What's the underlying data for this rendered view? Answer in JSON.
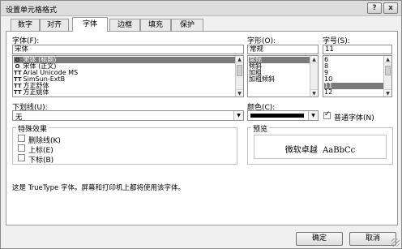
{
  "dialog": {
    "title": "设置单元格格式",
    "help_button": "?",
    "close_button": "x"
  },
  "tabs": [
    {
      "label": "数字"
    },
    {
      "label": "对齐"
    },
    {
      "label": "字体"
    },
    {
      "label": "边框"
    },
    {
      "label": "填充"
    },
    {
      "label": "保护"
    }
  ],
  "active_tab": "字体",
  "font": {
    "label": "字体(F):",
    "value": "宋体",
    "items": [
      {
        "name": "宋体 (标题)",
        "icon": "O"
      },
      {
        "name": "宋体 (正文)",
        "icon": "O"
      },
      {
        "name": "Arial Unicode MS",
        "icon": "TT"
      },
      {
        "name": "SimSun-ExtB",
        "icon": "TT"
      },
      {
        "name": "方正舒体",
        "icon": "TT"
      },
      {
        "name": "方正姚体",
        "icon": "TT"
      }
    ]
  },
  "style": {
    "label": "字形(O):",
    "value": "常规",
    "items": [
      "常规",
      "倾斜",
      "加粗",
      "加粗倾斜"
    ]
  },
  "size": {
    "label": "字号(S):",
    "value": "11",
    "items": [
      "6",
      "8",
      "9",
      "10",
      "11",
      "12"
    ]
  },
  "underline": {
    "label": "下划线(U):",
    "value": "无"
  },
  "color": {
    "label": "颜色(C):",
    "value_color": "#000000"
  },
  "normal_font": {
    "label": "普通字体(N)",
    "checked": true
  },
  "effects": {
    "title": "特殊效果",
    "items": [
      {
        "label": "删除线(K)",
        "checked": false
      },
      {
        "label": "上标(E)",
        "checked": false
      },
      {
        "label": "下标(B)",
        "checked": false
      }
    ]
  },
  "preview": {
    "title": "预览",
    "sample": "微软卓越  AaBbCc"
  },
  "description": "这是 TrueType 字体。屏幕和打印机上都将使用该字体。",
  "buttons": {
    "ok": "确定",
    "cancel": "取消"
  }
}
